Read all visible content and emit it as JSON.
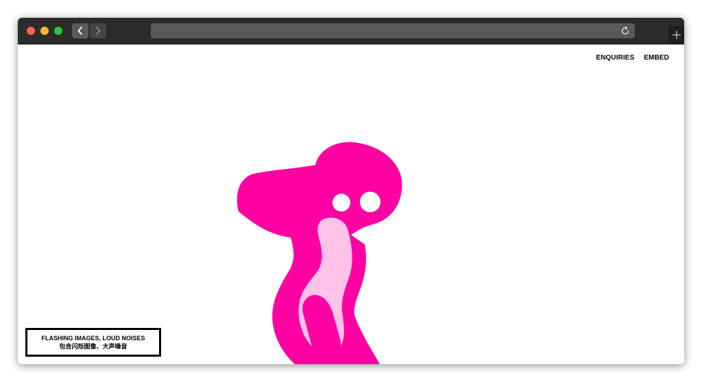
{
  "browser": {
    "icons": {
      "back": "chevron-left-icon",
      "forward": "chevron-right-icon",
      "reload": "reload-icon",
      "new_tab": "plus-icon"
    },
    "colors": {
      "close": "#fe5f57",
      "minimize": "#febc2e",
      "zoom": "#28c840"
    }
  },
  "nav": {
    "enquiries": "ENQUIRIES",
    "embed": "EMBED"
  },
  "warning": {
    "line1": "FLASHING IMAGES, LOUD NOISES",
    "line2": "包含闪烁图像、大声噪音"
  },
  "colors": {
    "character_body": "#ff00a2",
    "character_belly": "#ffc2e8",
    "eyes": "#ffffff"
  }
}
